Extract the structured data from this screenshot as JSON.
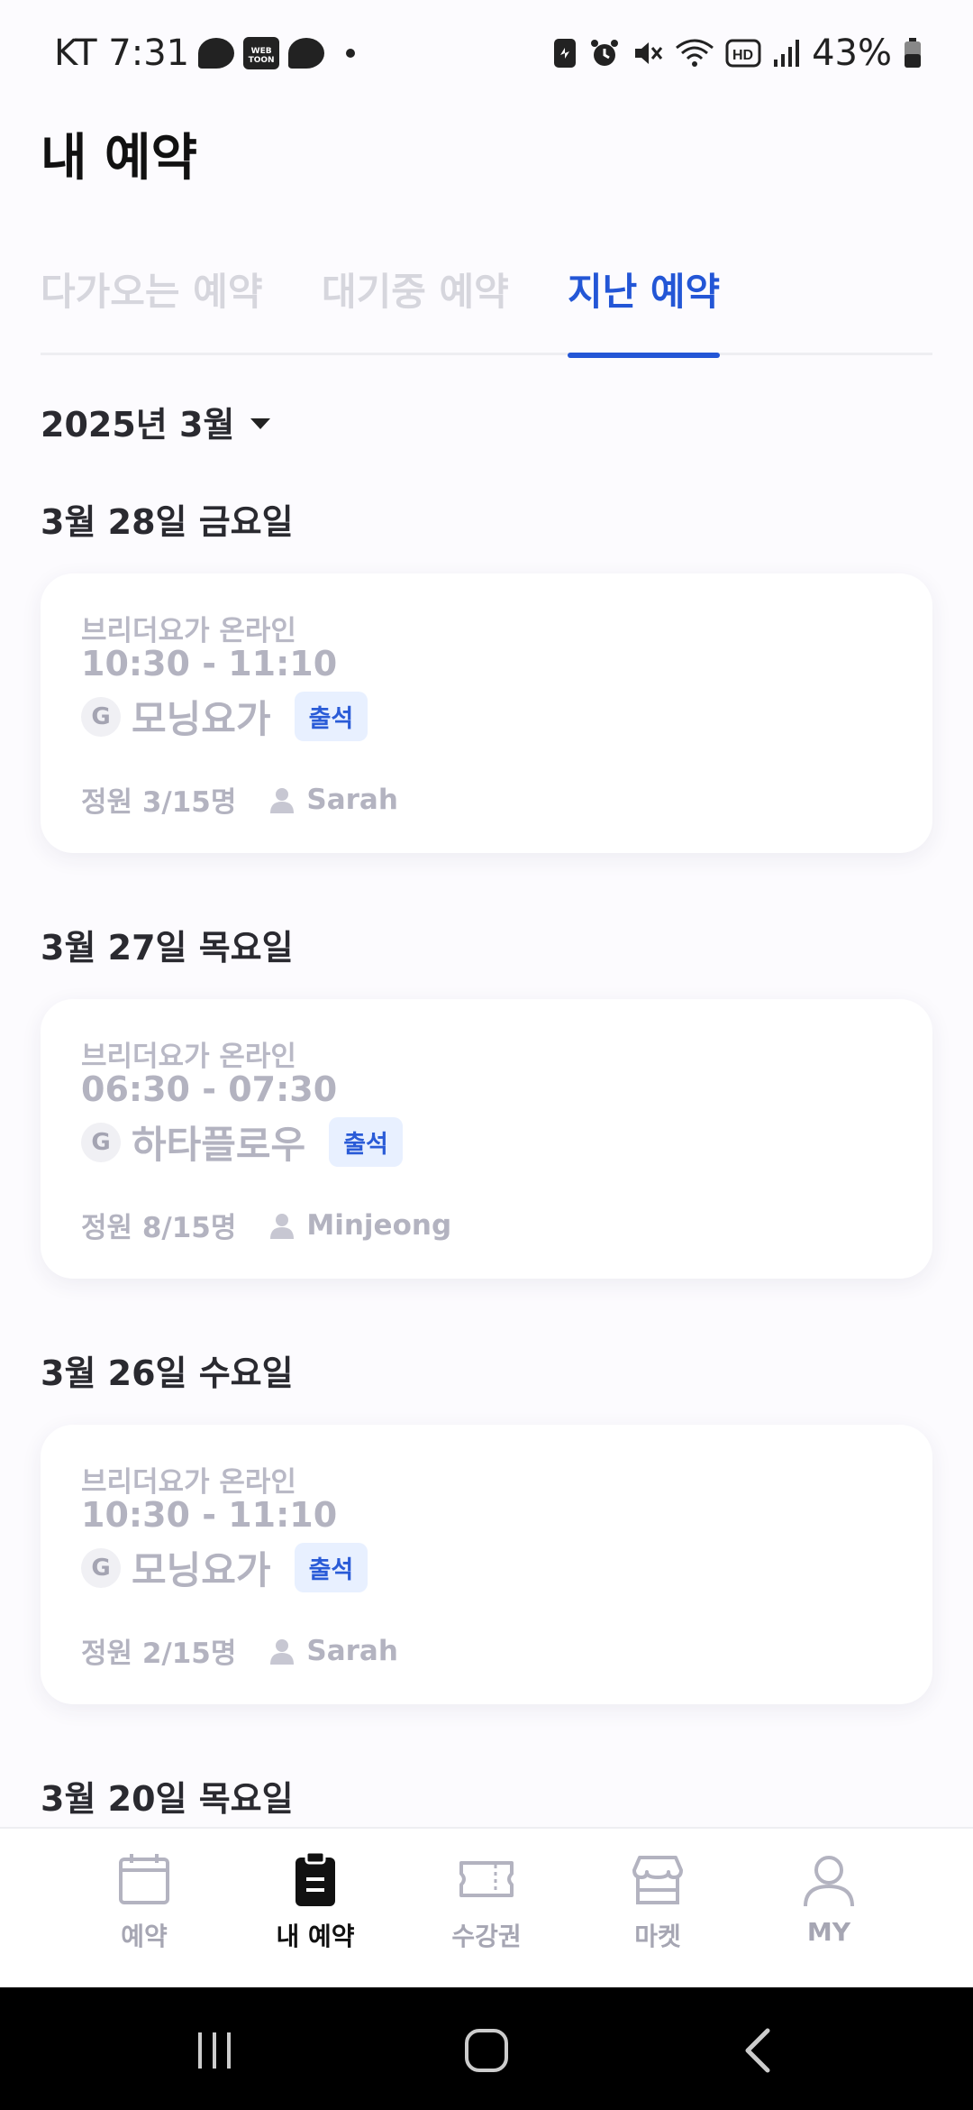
{
  "status_bar": {
    "carrier_time": "KT 7:31",
    "battery": "43%",
    "webtoon_label": "WEB TOON"
  },
  "header": {
    "title": "내 예약"
  },
  "tabs": [
    {
      "label": "다가오는 예약",
      "active": false
    },
    {
      "label": "대기중 예약",
      "active": false
    },
    {
      "label": "지난 예약",
      "active": true
    }
  ],
  "month_selector": {
    "label": "2025년 3월"
  },
  "reservations": [
    {
      "date": "3월 28일 금요일",
      "studio": "브리더요가 온라인",
      "time": "10:30 - 11:10",
      "type_badge": "G",
      "class_name": "모닝요가",
      "status": "출석",
      "capacity": "정원 3/15명",
      "instructor": "Sarah"
    },
    {
      "date": "3월 27일 목요일",
      "studio": "브리더요가 온라인",
      "time": "06:30 - 07:30",
      "type_badge": "G",
      "class_name": "하타플로우",
      "status": "출석",
      "capacity": "정원 8/15명",
      "instructor": "Minjeong"
    },
    {
      "date": "3월 26일 수요일",
      "studio": "브리더요가 온라인",
      "time": "10:30 - 11:10",
      "type_badge": "G",
      "class_name": "모닝요가",
      "status": "출석",
      "capacity": "정원 2/15명",
      "instructor": "Sarah"
    },
    {
      "date": "3월 20일 목요일"
    }
  ],
  "bottom_nav": [
    {
      "label": "예약",
      "icon": "calendar-icon",
      "active": false
    },
    {
      "label": "내 예약",
      "icon": "clipboard-icon",
      "active": true
    },
    {
      "label": "수강권",
      "icon": "ticket-icon",
      "active": false
    },
    {
      "label": "마켓",
      "icon": "store-icon",
      "active": false
    },
    {
      "label": "MY",
      "icon": "user-icon",
      "active": false
    }
  ],
  "colors": {
    "accent": "#2356d6",
    "muted_text": "#b3b3c0",
    "badge_bg": "#e8f0ff"
  }
}
